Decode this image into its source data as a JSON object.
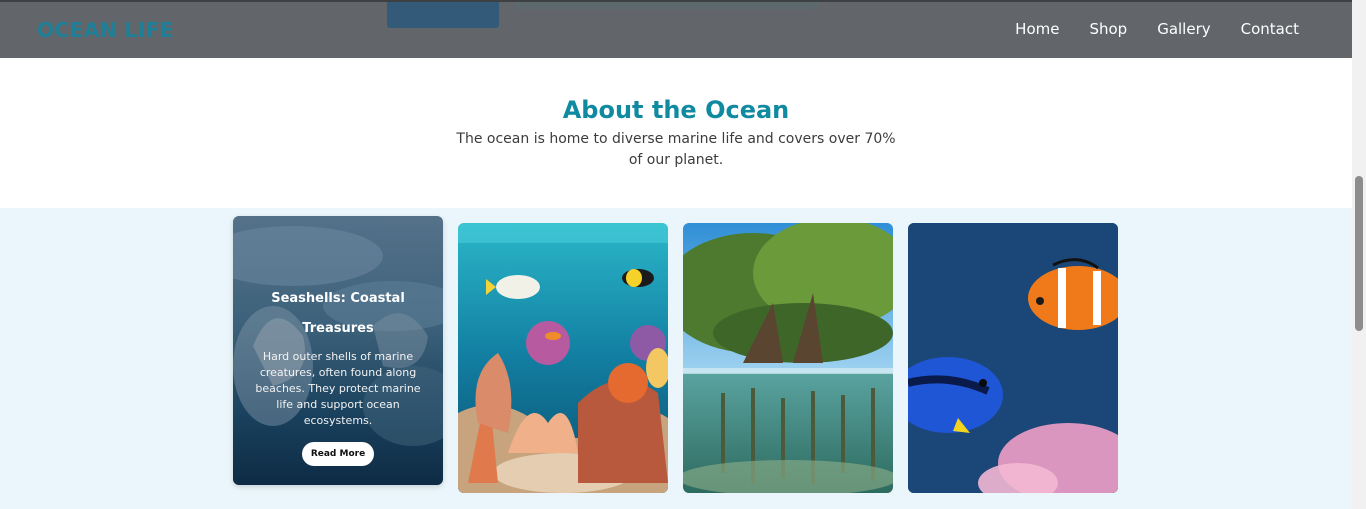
{
  "header": {
    "logo": "OCEAN LIFE",
    "nav": [
      "Home",
      "Shop",
      "Gallery",
      "Contact"
    ]
  },
  "about": {
    "title": "About the Ocean",
    "text": "The ocean is home to diverse marine life and covers over 70% of our planet."
  },
  "cards": {
    "featured": {
      "title": "Seashells: Coastal Treasures",
      "description": "Hard outer shells of marine creatures, often found along beaches. They protect marine life and support ocean ecosystems.",
      "button": "Read More"
    },
    "images": [
      "coral-reef-image",
      "mangrove-image",
      "clownfish-tang-image"
    ]
  },
  "colors": {
    "accent": "#0f8aa0",
    "header_bg": "#62666a",
    "gallery_bg": "#eaf6fb"
  }
}
